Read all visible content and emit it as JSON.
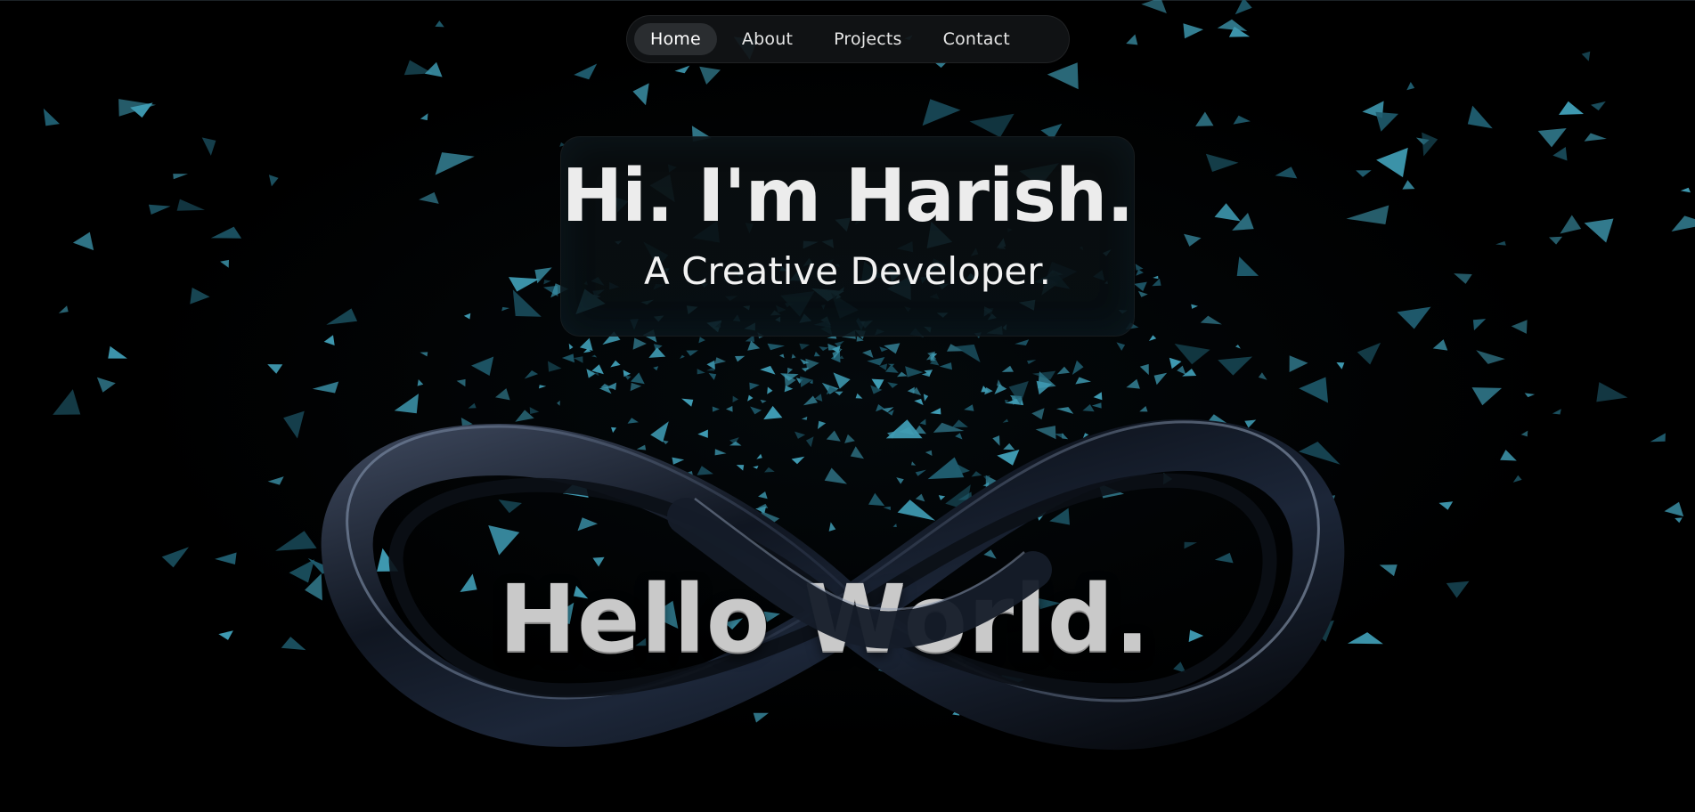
{
  "nav": {
    "items": [
      {
        "label": "Home",
        "active": true
      },
      {
        "label": "About",
        "active": false
      },
      {
        "label": "Projects",
        "active": false
      },
      {
        "label": "Contact",
        "active": false
      }
    ]
  },
  "hero": {
    "title": "Hi. I'm Harish.",
    "subtitle": "A Creative Developer."
  },
  "scene": {
    "headline": "Hello World."
  },
  "colors": {
    "background": "#000000",
    "shard": "#3f9bb3",
    "shard_dark": "#1f5c6e",
    "ribbon": "#1b2333",
    "ribbon_highlight": "#7f8fa6",
    "text_light": "#ececec",
    "text_metal": "#c9c9c9"
  }
}
